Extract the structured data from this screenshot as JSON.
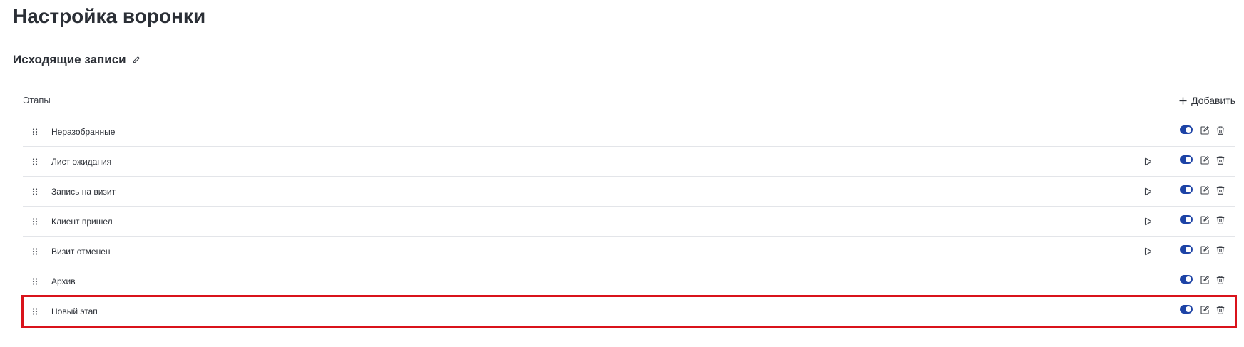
{
  "page_title": "Настройка воронки",
  "funnel": {
    "name": "Исходящие записи",
    "edit_icon": "pencil-icon"
  },
  "stages_section": {
    "label": "Этапы",
    "add_label": "Добавить",
    "add_icon": "plus-icon"
  },
  "colors": {
    "toggle_on": "#1d43a6",
    "highlight": "#d9131b",
    "divider": "#e3e5e9"
  },
  "stages": [
    {
      "name": "Неразобранные",
      "has_automation": false,
      "enabled": true
    },
    {
      "name": "Лист ожидания",
      "has_automation": true,
      "enabled": true
    },
    {
      "name": "Запись на визит",
      "has_automation": true,
      "enabled": true
    },
    {
      "name": "Клиент пришел",
      "has_automation": true,
      "enabled": true
    },
    {
      "name": "Визит отменен",
      "has_automation": true,
      "enabled": true
    },
    {
      "name": "Архив",
      "has_automation": false,
      "enabled": true
    },
    {
      "name": "Новый этап",
      "has_automation": false,
      "enabled": true,
      "highlighted": true
    }
  ],
  "row_icons": {
    "drag": "drag-handle-icon",
    "automation": "play-icon",
    "toggle": "toggle-switch",
    "edit": "edit-icon",
    "delete": "trash-icon"
  }
}
